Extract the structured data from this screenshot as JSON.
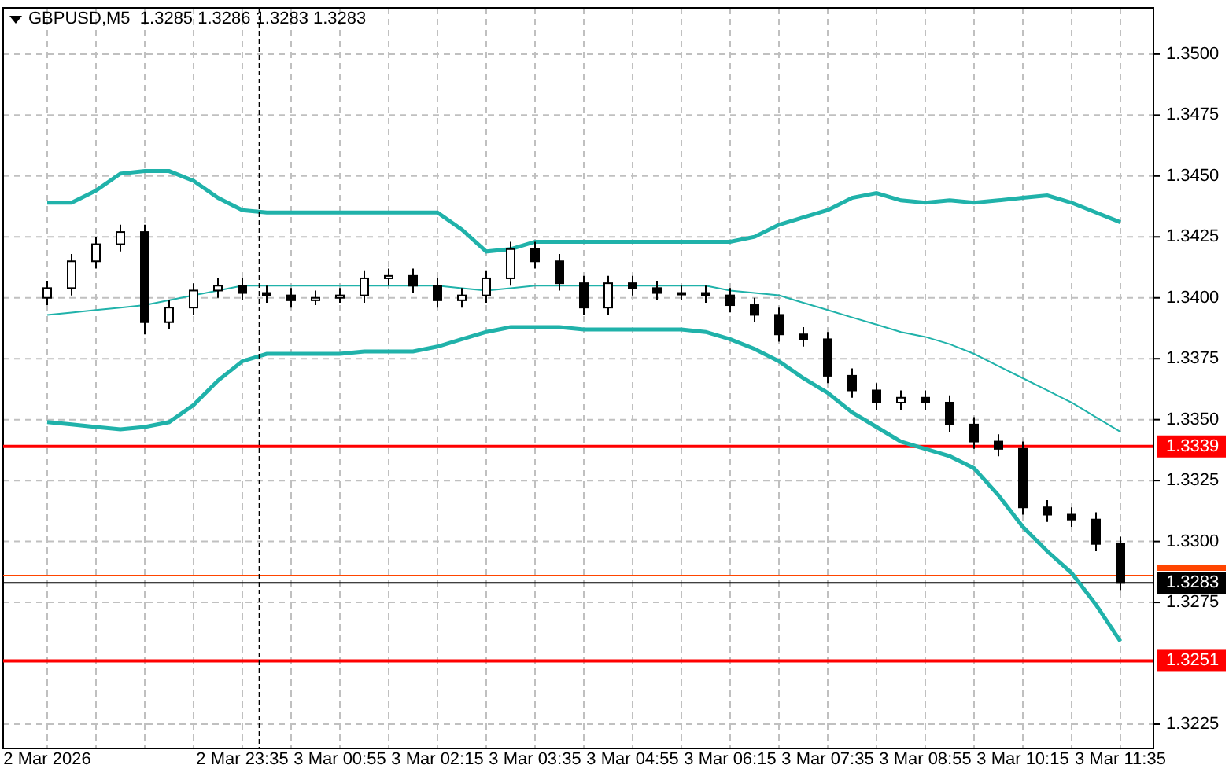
{
  "window": {
    "title": "GBPUSD,M5  1.3285 1.3286 1.3283 1.3283"
  },
  "chart": {
    "chart_data": {
      "type": "candlestick",
      "categories": [
        "2 Mar 2026",
        null,
        null,
        null,
        null,
        null,
        null,
        null,
        "2 Mar 23:35",
        null,
        null,
        null,
        "3 Mar 00:55",
        null,
        null,
        null,
        "3 Mar 02:15",
        null,
        null,
        null,
        "3 Mar 03:35",
        null,
        null,
        null,
        "3 Mar 04:55",
        null,
        null,
        null,
        "3 Mar 06:15",
        null,
        null,
        null,
        "3 Mar 07:35",
        null,
        null,
        null,
        "3 Mar 08:55",
        null,
        null,
        null,
        "3 Mar 10:15",
        null,
        null,
        null,
        "3 Mar 11:35"
      ],
      "ohlc": [
        [
          1.34,
          1.3407,
          1.3397,
          1.3404
        ],
        [
          1.3404,
          1.3418,
          1.3401,
          1.3415
        ],
        [
          1.3415,
          1.3425,
          1.3412,
          1.3422
        ],
        [
          1.3422,
          1.343,
          1.3419,
          1.3427
        ],
        [
          1.3427,
          1.343,
          1.3385,
          1.339
        ],
        [
          1.339,
          1.3399,
          1.3387,
          1.3396
        ],
        [
          1.3396,
          1.3406,
          1.3393,
          1.3403
        ],
        [
          1.3403,
          1.3408,
          1.34,
          1.3405
        ],
        [
          1.3405,
          1.3408,
          1.3399,
          1.3402
        ],
        [
          1.3402,
          1.3405,
          1.3398,
          1.3401
        ],
        [
          1.3401,
          1.3404,
          1.3396,
          1.3399
        ],
        [
          1.3399,
          1.3403,
          1.3397,
          1.34
        ],
        [
          1.34,
          1.3404,
          1.3398,
          1.3401
        ],
        [
          1.3401,
          1.3411,
          1.3398,
          1.3408
        ],
        [
          1.3408,
          1.3412,
          1.3405,
          1.3409
        ],
        [
          1.3409,
          1.3412,
          1.3402,
          1.3405
        ],
        [
          1.3405,
          1.3408,
          1.3396,
          1.3399
        ],
        [
          1.3399,
          1.3404,
          1.3396,
          1.3401
        ],
        [
          1.3401,
          1.3411,
          1.3398,
          1.3408
        ],
        [
          1.3408,
          1.3423,
          1.3405,
          1.342
        ],
        [
          1.342,
          1.3423,
          1.3412,
          1.3415
        ],
        [
          1.3415,
          1.3418,
          1.3403,
          1.3406
        ],
        [
          1.3406,
          1.3409,
          1.3393,
          1.3396
        ],
        [
          1.3396,
          1.3409,
          1.3393,
          1.3406
        ],
        [
          1.3406,
          1.3409,
          1.3401,
          1.3404
        ],
        [
          1.3404,
          1.3407,
          1.3399,
          1.3402
        ],
        [
          1.3402,
          1.3405,
          1.3399,
          1.3402
        ],
        [
          1.3402,
          1.3405,
          1.3398,
          1.3401
        ],
        [
          1.3401,
          1.3404,
          1.3394,
          1.3397
        ],
        [
          1.3397,
          1.34,
          1.339,
          1.3393
        ],
        [
          1.3393,
          1.3396,
          1.3382,
          1.3385
        ],
        [
          1.3385,
          1.3388,
          1.338,
          1.3383
        ],
        [
          1.3383,
          1.3386,
          1.3365,
          1.3368
        ],
        [
          1.3368,
          1.3371,
          1.3359,
          1.3362
        ],
        [
          1.3362,
          1.3365,
          1.3354,
          1.3357
        ],
        [
          1.3357,
          1.3362,
          1.3354,
          1.3359
        ],
        [
          1.3359,
          1.3362,
          1.3354,
          1.3357
        ],
        [
          1.3357,
          1.336,
          1.3345,
          1.3348
        ],
        [
          1.3348,
          1.3351,
          1.3338,
          1.3341
        ],
        [
          1.3341,
          1.3344,
          1.3335,
          1.3338
        ],
        [
          1.3338,
          1.3341,
          1.3311,
          1.3314
        ],
        [
          1.3314,
          1.3317,
          1.3308,
          1.3311
        ],
        [
          1.3311,
          1.3314,
          1.3306,
          1.3309
        ],
        [
          1.3309,
          1.3312,
          1.3296,
          1.3299
        ],
        [
          1.3299,
          1.3302,
          1.328,
          1.3283
        ]
      ],
      "series": [
        {
          "type": "line",
          "color": "#20b2aa",
          "values": [
            1.3439,
            1.3439,
            1.3444,
            1.3451,
            1.3452,
            1.3452,
            1.3448,
            1.3441,
            1.3436,
            1.3435,
            1.3435,
            1.3435,
            1.3435,
            1.3435,
            1.3435,
            1.3435,
            1.3435,
            1.3428,
            1.3419,
            1.342,
            1.3423,
            1.3423,
            1.3423,
            1.3423,
            1.3423,
            1.3423,
            1.3423,
            1.3423,
            1.3423,
            1.3425,
            1.343,
            1.3433,
            1.3436,
            1.3441,
            1.3443,
            1.344,
            1.3439,
            1.344,
            1.3439,
            1.344,
            1.3441,
            1.3442,
            1.3439,
            1.3435,
            1.3431
          ]
        },
        {
          "type": "line",
          "color": "#20b2aa",
          "values": [
            1.3393,
            1.3394,
            1.3395,
            1.3396,
            1.3397,
            1.3399,
            1.3401,
            1.3403,
            1.3405,
            1.3405,
            1.3405,
            1.3405,
            1.3405,
            1.3405,
            1.3405,
            1.3405,
            1.3405,
            1.3404,
            1.3403,
            1.3404,
            1.3405,
            1.3405,
            1.3405,
            1.3405,
            1.3405,
            1.3405,
            1.3405,
            1.3405,
            1.3403,
            1.3402,
            1.3401,
            1.3398,
            1.3395,
            1.3392,
            1.3389,
            1.3386,
            1.3384,
            1.3381,
            1.3377,
            1.3372,
            1.3367,
            1.3362,
            1.3357,
            1.3351,
            1.3345
          ]
        },
        {
          "type": "line",
          "color": "#20b2aa",
          "values": [
            1.3349,
            1.3348,
            1.3347,
            1.3346,
            1.3347,
            1.3349,
            1.3356,
            1.3366,
            1.3374,
            1.3377,
            1.3377,
            1.3377,
            1.3377,
            1.3378,
            1.3378,
            1.3378,
            1.338,
            1.3383,
            1.3386,
            1.3388,
            1.3388,
            1.3388,
            1.3387,
            1.3387,
            1.3387,
            1.3387,
            1.3387,
            1.3386,
            1.3383,
            1.3379,
            1.3374,
            1.3367,
            1.3361,
            1.3353,
            1.3347,
            1.3341,
            1.3338,
            1.3335,
            1.333,
            1.3319,
            1.3306,
            1.3296,
            1.3287,
            1.3274,
            1.3259
          ]
        }
      ],
      "ylim": [
        1.3215,
        1.3519
      ],
      "grid": true,
      "yticks": [
        {
          "value": 1.3225,
          "label": "1.3225"
        },
        {
          "value": 1.3275,
          "label": "1.3275"
        },
        {
          "value": 1.33,
          "label": "1.3300"
        },
        {
          "value": 1.3325,
          "label": "1.3325"
        },
        {
          "value": 1.335,
          "label": "1.3350"
        },
        {
          "value": 1.3375,
          "label": "1.3375"
        },
        {
          "value": 1.34,
          "label": "1.3400"
        },
        {
          "value": 1.3425,
          "label": "1.3425"
        },
        {
          "value": 1.345,
          "label": "1.3450"
        },
        {
          "value": 1.3475,
          "label": "1.3475"
        },
        {
          "value": 1.35,
          "label": "1.3500"
        }
      ],
      "ref_lines": [
        {
          "axis": "y",
          "value": 1.3339,
          "label": "1.3339",
          "color": "#ff0000"
        },
        {
          "axis": "y",
          "value": 1.3251,
          "label": "1.3251",
          "color": "#ff0000"
        },
        {
          "axis": "y",
          "value": 1.3286,
          "color": "#ff4500"
        },
        {
          "axis": "y",
          "value": 1.3283,
          "label": "1.3283",
          "color": "#000000"
        }
      ]
    }
  }
}
